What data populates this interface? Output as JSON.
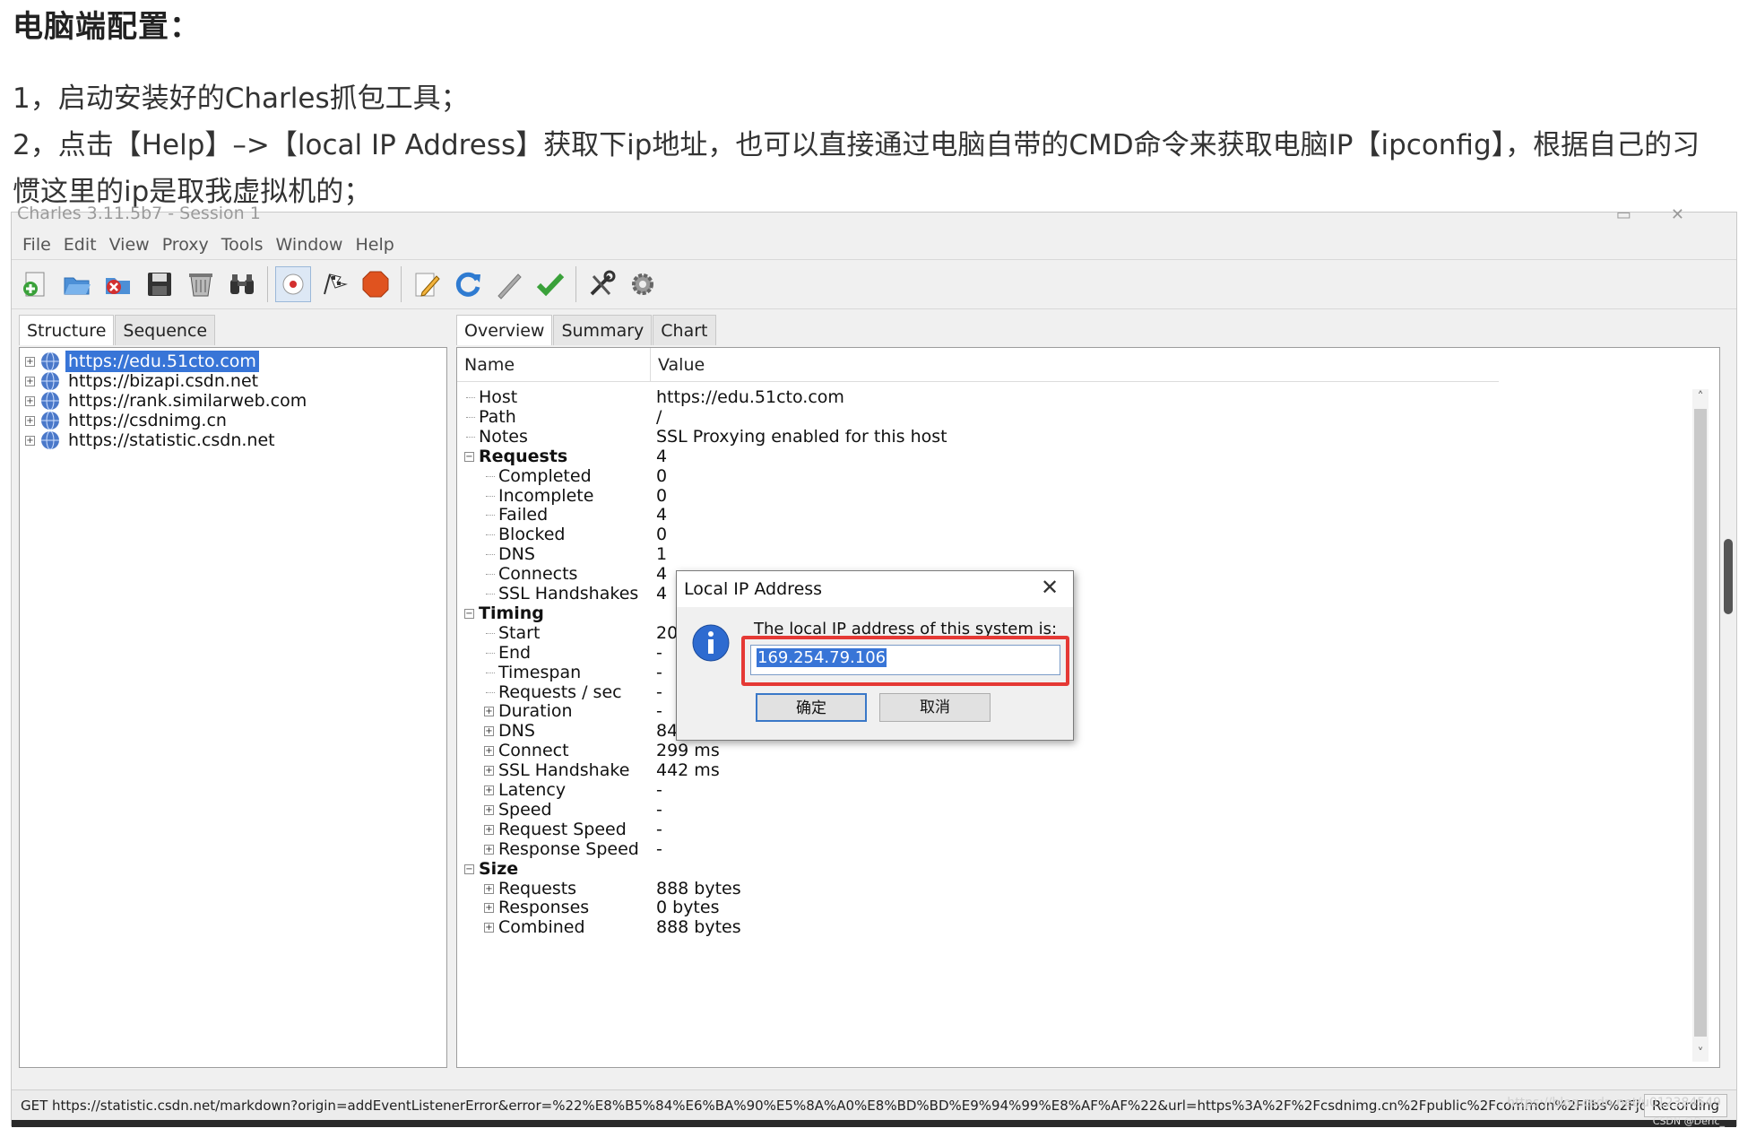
{
  "article": {
    "heading": "电脑端配置：",
    "line1": "1，启动安装好的Charles抓包工具；",
    "line2": "2，点击【Help】–>【local IP Address】获取下ip地址，也可以直接通过电脑自带的CMD命令来获取电脑IP【ipconfig】，根据自己的习",
    "line3": "惯这里的ip是取我虚拟机的；"
  },
  "window": {
    "title": "Charles 3.11.5b7 - Session 1",
    "menu": [
      "File",
      "Edit",
      "View",
      "Proxy",
      "Tools",
      "Window",
      "Help"
    ],
    "toolbar_icons": [
      "new-session-icon",
      "open-icon",
      "close-session-icon",
      "save-icon",
      "clear-icon",
      "find-icon",
      "record-icon",
      "throttle-icon",
      "breakpoints-icon",
      "edit-icon",
      "repeat-icon",
      "compose-icon",
      "validate-icon",
      "tools-icon",
      "settings-icon"
    ]
  },
  "left_pane": {
    "tabs": [
      "Structure",
      "Sequence"
    ],
    "hosts": [
      "https://edu.51cto.com",
      "https://bizapi.csdn.net",
      "https://rank.similarweb.com",
      "https://csdnimg.cn",
      "https://statistic.csdn.net"
    ]
  },
  "right_pane": {
    "tabs": [
      "Overview",
      "Summary",
      "Chart"
    ],
    "col_name": "Name",
    "col_value": "Value",
    "rows": [
      {
        "name": "Host",
        "value": "https://edu.51cto.com",
        "level": 0,
        "bold": false
      },
      {
        "name": "Path",
        "value": "/",
        "level": 0,
        "bold": false
      },
      {
        "name": "Notes",
        "value": "SSL Proxying enabled for this host",
        "level": 0,
        "bold": false
      },
      {
        "name": "Requests",
        "value": "4",
        "level": 0,
        "bold": true,
        "expander": "−"
      },
      {
        "name": "Completed",
        "value": "0",
        "level": 1,
        "bold": false
      },
      {
        "name": "Incomplete",
        "value": "0",
        "level": 1,
        "bold": false
      },
      {
        "name": "Failed",
        "value": "4",
        "level": 1,
        "bold": false
      },
      {
        "name": "Blocked",
        "value": "0",
        "level": 1,
        "bold": false
      },
      {
        "name": "DNS",
        "value": "1",
        "level": 1,
        "bold": false
      },
      {
        "name": "Connects",
        "value": "4",
        "level": 1,
        "bold": false
      },
      {
        "name": "SSL Handshakes",
        "value": "4",
        "level": 1,
        "bold": false
      },
      {
        "name": "Timing",
        "value": "",
        "level": 0,
        "bold": true,
        "expander": "−"
      },
      {
        "name": "Start",
        "value": "20",
        "level": 1,
        "bold": false
      },
      {
        "name": "End",
        "value": "-",
        "level": 1,
        "bold": false
      },
      {
        "name": "Timespan",
        "value": "-",
        "level": 1,
        "bold": false
      },
      {
        "name": "Requests / sec",
        "value": "-",
        "level": 1,
        "bold": false
      },
      {
        "name": "Duration",
        "value": "-",
        "level": 1,
        "bold": false,
        "expander": "+"
      },
      {
        "name": "DNS",
        "value": "84 ms",
        "level": 1,
        "bold": false,
        "expander": "+"
      },
      {
        "name": "Connect",
        "value": "299 ms",
        "level": 1,
        "bold": false,
        "expander": "+"
      },
      {
        "name": "SSL Handshake",
        "value": "442 ms",
        "level": 1,
        "bold": false,
        "expander": "+"
      },
      {
        "name": "Latency",
        "value": "-",
        "level": 1,
        "bold": false,
        "expander": "+"
      },
      {
        "name": "Speed",
        "value": "-",
        "level": 1,
        "bold": false,
        "expander": "+"
      },
      {
        "name": "Request Speed",
        "value": "-",
        "level": 1,
        "bold": false,
        "expander": "+"
      },
      {
        "name": "Response Speed",
        "value": "-",
        "level": 1,
        "bold": false,
        "expander": "+"
      },
      {
        "name": "Size",
        "value": "",
        "level": 0,
        "bold": true,
        "expander": "−"
      },
      {
        "name": "Requests",
        "value": "888 bytes",
        "level": 1,
        "bold": false,
        "expander": "+"
      },
      {
        "name": "Responses",
        "value": "0 bytes",
        "level": 1,
        "bold": false,
        "expander": "+"
      },
      {
        "name": "Combined",
        "value": "888 bytes",
        "level": 1,
        "bold": false,
        "expander": "+"
      }
    ]
  },
  "dialog": {
    "title": "Local IP Address",
    "message": "The local IP address of this system is:",
    "ip": "169.254.79.106",
    "ok": "确定",
    "cancel": "取消"
  },
  "status": {
    "request": "GET https://statistic.csdn.net/markdown?origin=addEventListenerError&error=%22%E8%B5%84%E6%BA%90%E5%8A%A0%E8%BD%BD%E9%94%99%E8%AF%AF%22&url=https%3A%2F%2Fcsdnimg.cn%2Fpublic%2Fcommon%2Flibs%2Fjquery%2Fjq...",
    "recording": "Recording"
  },
  "watermark": "https://blog.csdn.net/u012384549",
  "watermark2": "CSDN @Deric_",
  "colors": {
    "selection": "#3875d7",
    "highlight_border": "#e53935"
  }
}
